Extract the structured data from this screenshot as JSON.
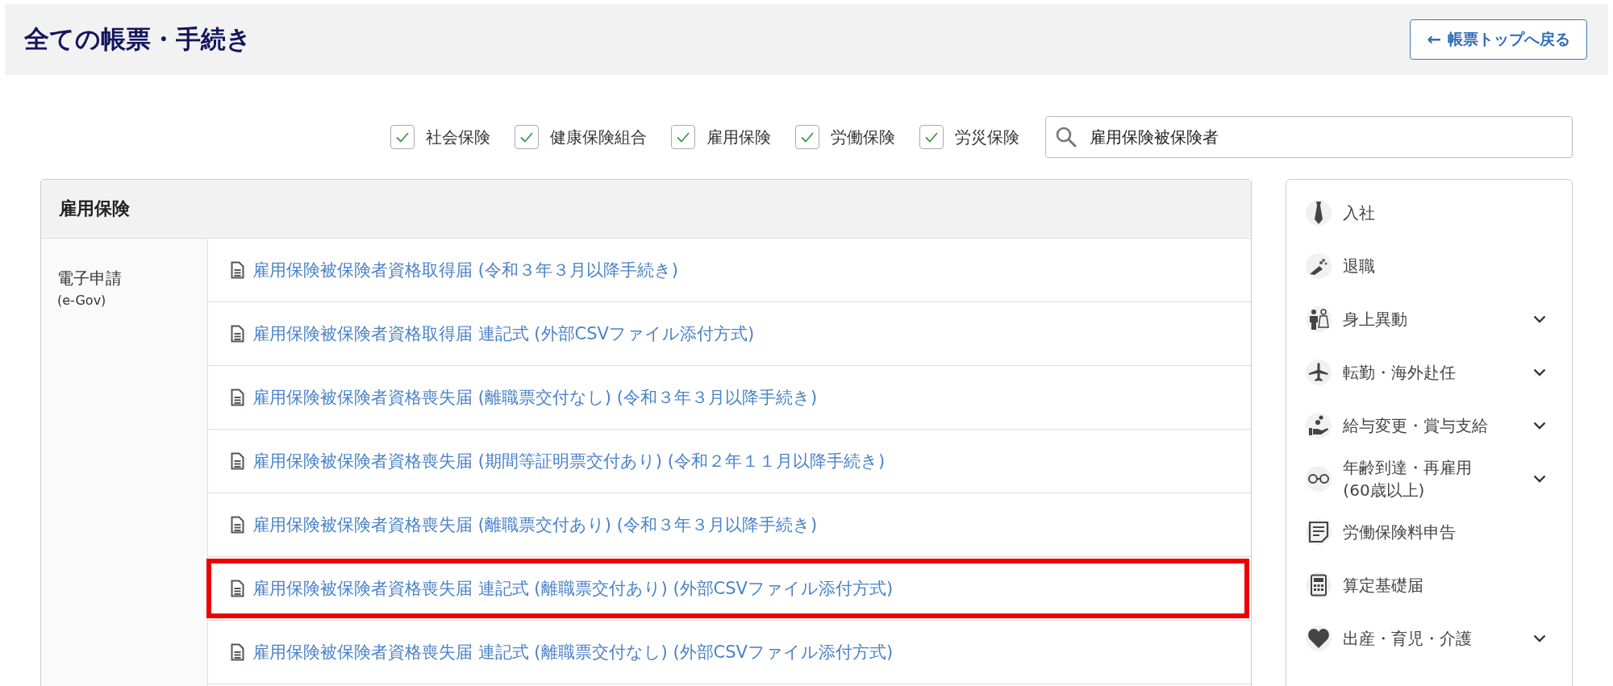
{
  "header": {
    "title": "全ての帳票・手続き",
    "back_button": {
      "arrow": "←",
      "label": "帳票トップへ戻る"
    }
  },
  "filters": [
    {
      "label": "社会保険",
      "checked": true
    },
    {
      "label": "健康保険組合",
      "checked": true
    },
    {
      "label": "雇用保険",
      "checked": true
    },
    {
      "label": "労働保険",
      "checked": true
    },
    {
      "label": "労災保険",
      "checked": true
    }
  ],
  "search": {
    "value": "雇用保険被保険者"
  },
  "section": {
    "title": "雇用保険",
    "category": {
      "label": "電子申請",
      "sublabel": "(e-Gov)"
    },
    "forms": [
      {
        "label": "雇用保険被保険者資格取得届 (令和３年３月以降手続き)",
        "highlighted": false
      },
      {
        "label": "雇用保険被保険者資格取得届 連記式 (外部CSVファイル添付方式)",
        "highlighted": false
      },
      {
        "label": "雇用保険被保険者資格喪失届 (離職票交付なし) (令和３年３月以降手続き)",
        "highlighted": false
      },
      {
        "label": "雇用保険被保険者資格喪失届 (期間等証明票交付あり) (令和２年１１月以降手続き)",
        "highlighted": false
      },
      {
        "label": "雇用保険被保険者資格喪失届 (離職票交付あり) (令和３年３月以降手続き)",
        "highlighted": false
      },
      {
        "label": "雇用保険被保険者資格喪失届 連記式 (離職票交付あり) (外部CSVファイル添付方式)",
        "highlighted": true
      },
      {
        "label": "雇用保険被保険者資格喪失届 連記式 (離職票交付なし) (外部CSVファイル添付方式)",
        "highlighted": false
      }
    ]
  },
  "sidebar": {
    "items": [
      {
        "kind": "tie",
        "label": "入社",
        "expandable": false
      },
      {
        "kind": "bouquet",
        "label": "退職",
        "expandable": false
      },
      {
        "kind": "couple",
        "label": "身上異動",
        "expandable": true
      },
      {
        "kind": "plane",
        "label": "転勤・海外赴任",
        "expandable": true
      },
      {
        "kind": "coins",
        "label": "給与変更・賞与支給",
        "expandable": true
      },
      {
        "kind": "glasses",
        "label": "年齢到達・再雇用\n(60歳以上)",
        "expandable": true
      },
      {
        "kind": "document",
        "label": "労働保険料申告",
        "expandable": false
      },
      {
        "kind": "calculator",
        "label": "算定基礎届",
        "expandable": false
      },
      {
        "kind": "heart",
        "label": "出産・育児・介護",
        "expandable": true
      }
    ]
  }
}
